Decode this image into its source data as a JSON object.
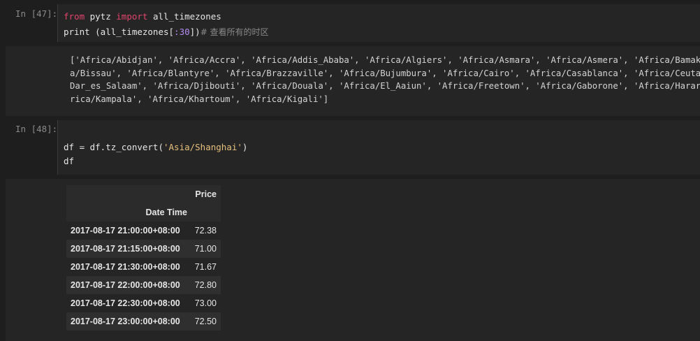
{
  "cells": [
    {
      "prompt": "In [47]:",
      "code": {
        "line1": {
          "kw_from": "from",
          "mod": " pytz ",
          "kw_import": "import",
          "name": " all_timezones"
        },
        "line2": {
          "fn": "print (all_timezones[",
          "slice": ":30",
          "close": "])",
          "comment": "# 查看所有的时区"
        }
      },
      "output_lines": [
        "['Africa/Abidjan', 'Africa/Accra', 'Africa/Addis_Ababa', 'Africa/Algiers', 'Africa/Asmara', 'Africa/Asmera', 'Africa/Bamako',",
        "a/Bissau', 'Africa/Blantyre', 'Africa/Brazzaville', 'Africa/Bujumbura', 'Africa/Cairo', 'Africa/Casablanca', 'Africa/Ceuta',",
        "Dar_es_Salaam', 'Africa/Djibouti', 'Africa/Douala', 'Africa/El_Aaiun', 'Africa/Freetown', 'Africa/Gaborone', 'Africa/Harare',",
        "rica/Kampala', 'Africa/Khartoum', 'Africa/Kigali']"
      ]
    },
    {
      "prompt": "In [48]:",
      "code": {
        "line1": {
          "pre": "df = df.tz_convert(",
          "str": "'Asia/Shanghai'",
          "post": ")"
        },
        "line2": {
          "text": "df"
        }
      }
    }
  ],
  "dataframe": {
    "column": "Price",
    "index_name": "Date Time",
    "rows": [
      {
        "index": "2017-08-17 21:00:00+08:00",
        "price": "72.38"
      },
      {
        "index": "2017-08-17 21:15:00+08:00",
        "price": "71.00"
      },
      {
        "index": "2017-08-17 21:30:00+08:00",
        "price": "71.67"
      },
      {
        "index": "2017-08-17 22:00:00+08:00",
        "price": "72.80"
      },
      {
        "index": "2017-08-17 22:30:00+08:00",
        "price": "73.00"
      },
      {
        "index": "2017-08-17 23:00:00+08:00",
        "price": "72.50"
      }
    ]
  }
}
